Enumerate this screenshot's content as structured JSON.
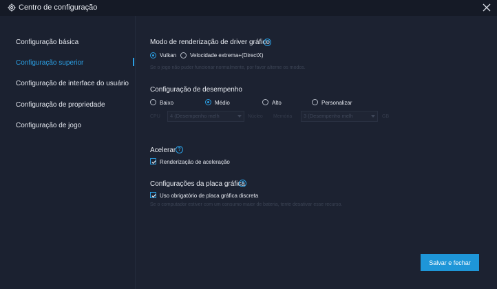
{
  "window": {
    "title": "Centro de configuração",
    "close_icon": "close-icon",
    "gear_icon": "gear-icon"
  },
  "sidebar": {
    "items": [
      {
        "label": "Configuração básica",
        "active": false
      },
      {
        "label": "Configuração superior",
        "active": true
      },
      {
        "label": "Configuração de interface do usuário",
        "active": false
      },
      {
        "label": "Configuração de propriedade",
        "active": false
      },
      {
        "label": "Configuração de jogo",
        "active": false
      }
    ]
  },
  "render_mode": {
    "title": "Modo de renderização de driver gráfico",
    "options": [
      {
        "label": "Vulkan",
        "selected": true
      },
      {
        "label": "Velocidade extrema+(DirectX)",
        "selected": false
      }
    ],
    "hint": "Se o jogo não puder funcionar normalmente, por favor alterne os modos."
  },
  "performance": {
    "title": "Configuração de desempenho",
    "options": [
      {
        "label": "Baixo",
        "selected": false
      },
      {
        "label": "Médio",
        "selected": true
      },
      {
        "label": "Alto",
        "selected": false
      },
      {
        "label": "Personalizar",
        "selected": false
      }
    ],
    "cpu_label": "CPU",
    "cpu_value": "4 (Desempenho melh",
    "cores_label": "Núcleo",
    "memory_label": "Memória",
    "memory_value": "3 (Desempenho melh",
    "memory_unit": "GB"
  },
  "accelerate": {
    "title": "Acelerar",
    "checkbox_label": "Renderização de aceleração",
    "checked": true
  },
  "gpu": {
    "title": "Configurações da placa gráfica",
    "checkbox_label": "Uso obrigatório de placa gráfica discreta",
    "checked": true,
    "hint": "Se o computador estiver com um consumo maior de bateria, tente desativar esse recurso."
  },
  "footer": {
    "save_label": "Salvar e fechar"
  },
  "colors": {
    "accent": "#2b9fe3",
    "background": "#1c2231",
    "titlebar": "#151a26",
    "button": "#1e96d8"
  }
}
